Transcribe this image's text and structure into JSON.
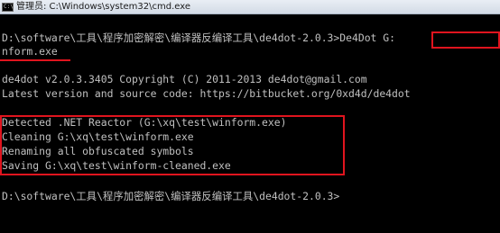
{
  "window": {
    "title": "管理员: C:\\Windows\\system32\\cmd.exe",
    "icon_text": "C:\\"
  },
  "console": {
    "lines": [
      "D:\\software\\工具\\程序加密解密\\编译器反编译工具\\de4dot-2.0.3>De4Dot G:",
      "nform.exe",
      "",
      "de4dot v2.0.3.3405 Copyright (C) 2011-2013 de4dot@gmail.com",
      "Latest version and source code: https://bitbucket.org/0xd4d/de4dot",
      "",
      "Detected .NET Reactor (G:\\xq\\test\\winform.exe)",
      "Cleaning G:\\xq\\test\\winform.exe",
      "Renaming all obfuscated symbols",
      "Saving G:\\xq\\test\\winform-cleaned.exe",
      "",
      "D:\\software\\工具\\程序加密解密\\编译器反编译工具\\de4dot-2.0.3>"
    ]
  },
  "colors": {
    "console_bg": "#000000",
    "console_fg": "#c0c0c0",
    "highlight": "#e0141e"
  }
}
